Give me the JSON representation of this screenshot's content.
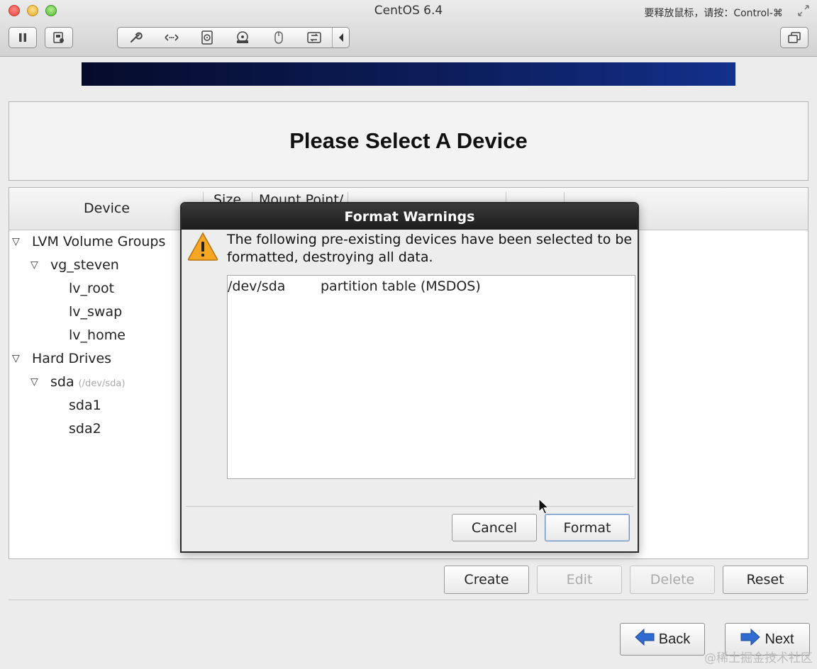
{
  "window": {
    "title": "CentOS 6.4",
    "release_hint": "要释放鼠标，请按：Control-⌘"
  },
  "toolbar": {
    "left_buttons": [
      "pause-icon",
      "snapshot-icon"
    ],
    "group_icons": [
      "wrench-icon",
      "network-icon",
      "cd-icon",
      "hdd-icon",
      "mouse-icon",
      "share-icon",
      "chevron-left-icon"
    ],
    "right_buttons": [
      "fullscreen-icon"
    ]
  },
  "installer": {
    "heading": "Please Select A Device",
    "columns": [
      "Device",
      "Size",
      "Mount Point/"
    ],
    "tree": [
      {
        "label": "LVM Volume Groups",
        "level": 0,
        "expander": "▽"
      },
      {
        "label": "vg_steven",
        "level": 1,
        "expander": "▽"
      },
      {
        "label": "lv_root",
        "level": 2
      },
      {
        "label": "lv_swap",
        "level": 2
      },
      {
        "label": "lv_home",
        "level": 2
      },
      {
        "label": "Hard Drives",
        "level": 0,
        "expander": "▽"
      },
      {
        "label": "sda",
        "level": 1,
        "expander": "▽",
        "path": "(/dev/sda)"
      },
      {
        "label": "sda1",
        "level": 2
      },
      {
        "label": "sda2",
        "level": 2
      }
    ],
    "actions": {
      "create": "Create",
      "edit": "Edit",
      "delete": "Delete",
      "reset": "Reset"
    },
    "nav": {
      "back": "Back",
      "next": "Next"
    }
  },
  "dialog": {
    "title": "Format Warnings",
    "message": "The following pre-existing devices have been selected to be formatted, destroying all data.",
    "devices": [
      {
        "device": "/dev/sda",
        "description": "partition table (MSDOS)"
      }
    ],
    "cancel": "Cancel",
    "format": "Format"
  },
  "watermark": "@稀土掘金技术社区",
  "colors": {
    "banner_start": "#050b2a",
    "banner_end": "#13308b",
    "dialog_title_bg": "#1c1c1c",
    "warning_icon": "#f0a020",
    "nav_arrow": "#2f6bd0"
  }
}
